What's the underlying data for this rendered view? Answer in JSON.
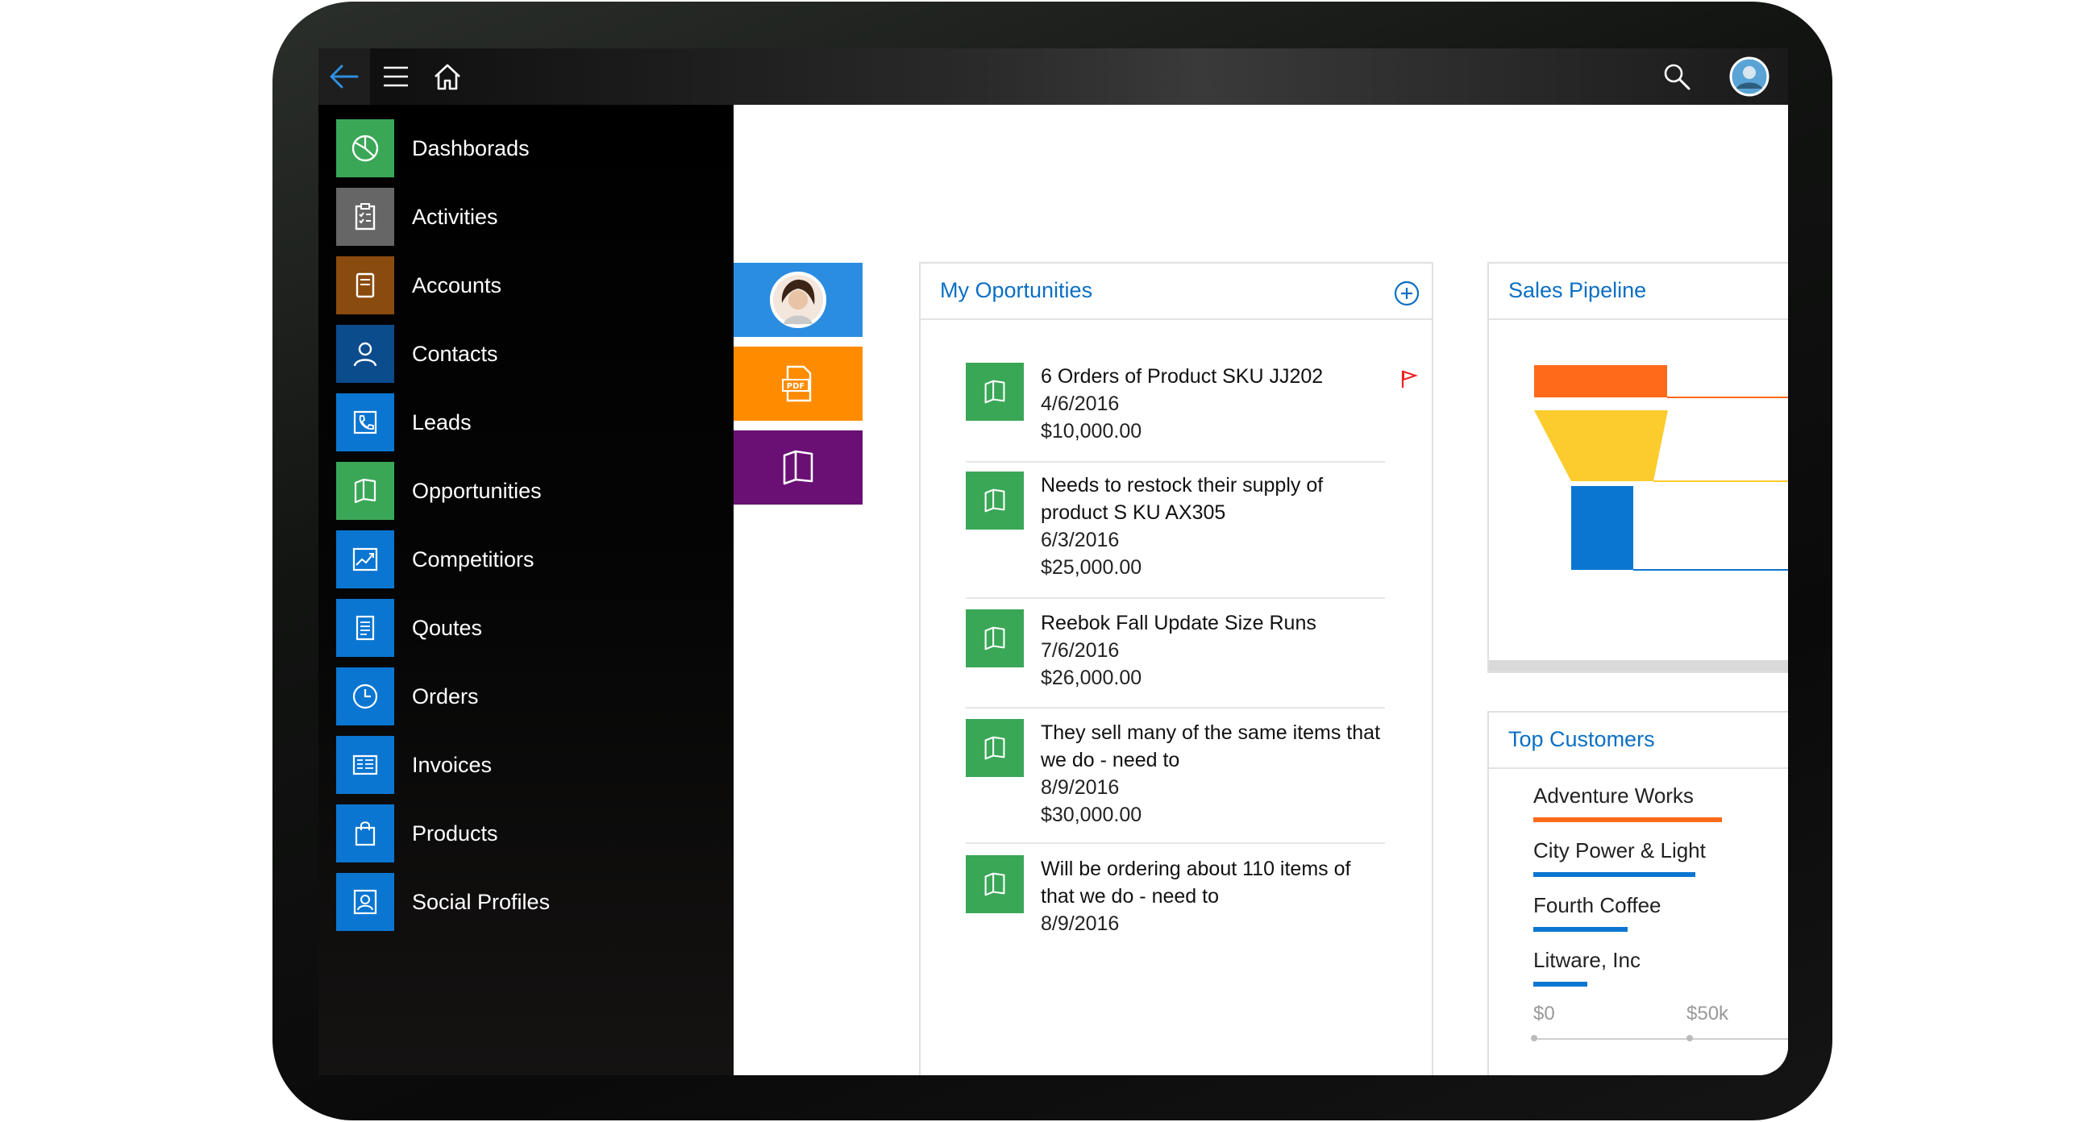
{
  "nav": {
    "items": [
      {
        "label": "Dashborads",
        "icon": "pie-chart-icon",
        "color": "#3aa757"
      },
      {
        "label": "Activities",
        "icon": "clipboard-icon",
        "color": "#666666"
      },
      {
        "label": "Accounts",
        "icon": "ledger-icon",
        "color": "#8a4b0f"
      },
      {
        "label": "Contacts",
        "icon": "person-icon",
        "color": "#0b4c8c"
      },
      {
        "label": "Leads",
        "icon": "phone-icon",
        "color": "#0b76d1"
      },
      {
        "label": "Opportunities",
        "icon": "map-icon",
        "color": "#3aa757"
      },
      {
        "label": "Competitiors",
        "icon": "trend-chart-icon",
        "color": "#0b76d1"
      },
      {
        "label": "Qoutes",
        "icon": "document-icon",
        "color": "#0b76d1"
      },
      {
        "label": "Orders",
        "icon": "clock-icon",
        "color": "#0b76d1"
      },
      {
        "label": "Invoices",
        "icon": "invoice-icon",
        "color": "#0b76d1"
      },
      {
        "label": "Products",
        "icon": "shopping-bag-icon",
        "color": "#0b76d1"
      },
      {
        "label": "Social Profiles",
        "icon": "profile-card-icon",
        "color": "#0b76d1"
      }
    ]
  },
  "quick_tiles": [
    {
      "icon": "avatar-icon",
      "color": "#2b8de0"
    },
    {
      "icon": "pdf-icon",
      "color": "#ff8c00"
    },
    {
      "icon": "map-icon",
      "color": "#6a0f74"
    }
  ],
  "opportunities": {
    "title": "My Oportunities",
    "items": [
      {
        "title": "6 Orders of Product SKU JJ202",
        "date": "4/6/2016",
        "amount": "$10,000.00",
        "flagged": true
      },
      {
        "title": "Needs to restock their supply of product S KU AX305",
        "date": "6/3/2016",
        "amount": "$25,000.00"
      },
      {
        "title": "Reebok Fall Update Size Runs",
        "date": "7/6/2016",
        "amount": "$26,000.00"
      },
      {
        "title": "They sell many of the same items that we do - need to",
        "date": "8/9/2016",
        "amount": "$30,000.00"
      },
      {
        "title": "Will be ordering about 110 items of that we do - need to",
        "date": "8/9/2016",
        "amount": ""
      }
    ]
  },
  "pipeline": {
    "title": "Sales Pipeline",
    "colors": [
      "#ff6a1a",
      "#fccc2e",
      "#0b76d1"
    ]
  },
  "customers": {
    "title": "Top Customers",
    "items": [
      {
        "name": "Adventure Works",
        "value": 0.7,
        "color": "#ff6a1a"
      },
      {
        "name": "City Power & Light",
        "value": 0.6,
        "color": "#0b76d1"
      },
      {
        "name": "Fourth Coffee",
        "value": 0.35,
        "color": "#0b76d1"
      },
      {
        "name": "Litware, Inc",
        "value": 0.2,
        "color": "#0b76d1"
      }
    ],
    "axis": {
      "min_label": "$0",
      "mid_label": "$50k"
    }
  }
}
